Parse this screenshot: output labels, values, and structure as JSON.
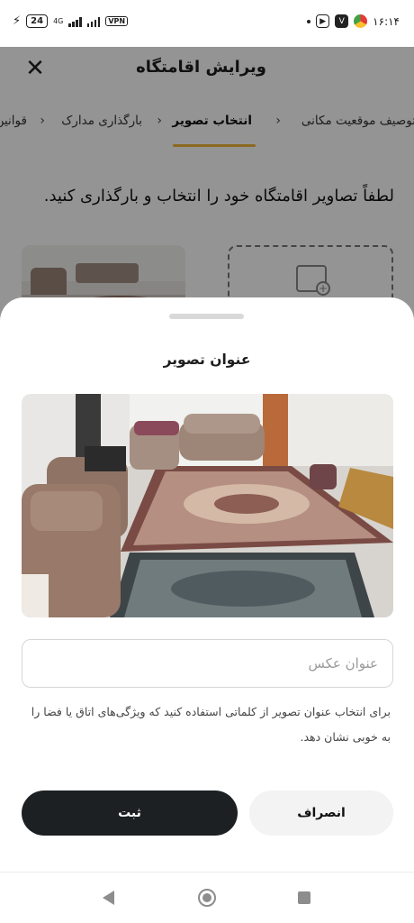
{
  "status_bar": {
    "battery": "24",
    "network": "4G",
    "vpn": "VPN",
    "time": "۱۶:۱۴"
  },
  "header": {
    "title": "ویرایش اقامتگاه"
  },
  "steps": [
    {
      "label": "توصیف موقعیت مکانی",
      "state": "completed"
    },
    {
      "label": "انتخاب تصویر",
      "state": "active"
    },
    {
      "label": "بارگذاری مدارک",
      "state": "pending"
    },
    {
      "label": "قوانین",
      "state": "pending"
    }
  ],
  "page": {
    "instruction": "لطفاً تصاویر اقامتگاه خود را انتخاب و بارگذاری کنید."
  },
  "sheet": {
    "title": "عنوان تصویر",
    "input_placeholder": "عنوان عکس",
    "input_value": "",
    "helper_text": "برای انتخاب عنوان تصویر از کلماتی استفاده کنید که ویژگی‌های اتاق یا فضا را به خوبی نشان دهد.",
    "submit_label": "ثبت",
    "cancel_label": "انصراف"
  },
  "colors": {
    "accent": "#f2b63a",
    "primary_button": "#1c2022",
    "secondary_button": "#f3f3f3"
  },
  "icons": {
    "close": "close-icon",
    "upload": "image-add-icon",
    "back": "back-icon",
    "home": "home-icon",
    "recent": "recents-icon"
  }
}
